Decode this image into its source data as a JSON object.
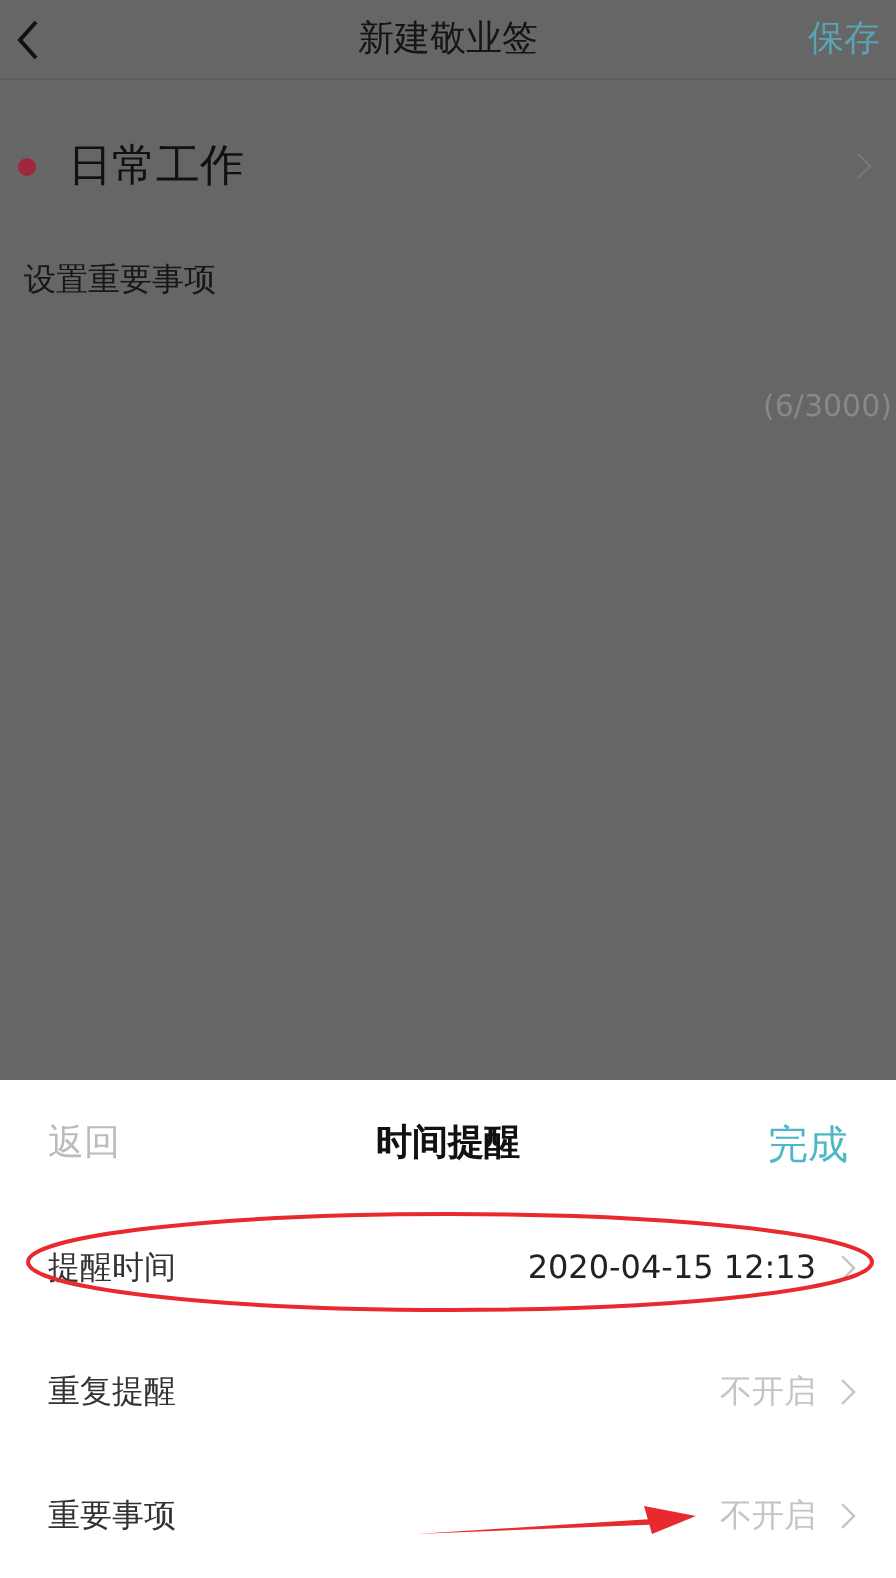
{
  "page": {
    "title": "新建敬业签",
    "save": "保存"
  },
  "category": {
    "name": "日常工作",
    "color": "#a0283c"
  },
  "note": {
    "text": "设置重要事项",
    "count": "(6/3000)"
  },
  "sheet": {
    "back": "返回",
    "title": "时间提醒",
    "done": "完成",
    "rows": [
      {
        "label": "提醒时间",
        "value": "2020-04-15 12:13",
        "set": true,
        "circled": true,
        "arrow": false
      },
      {
        "label": "重复提醒",
        "value": "不开启",
        "set": false,
        "circled": false,
        "arrow": false
      },
      {
        "label": "重要事项",
        "value": "不开启",
        "set": false,
        "circled": false,
        "arrow": true
      }
    ]
  }
}
